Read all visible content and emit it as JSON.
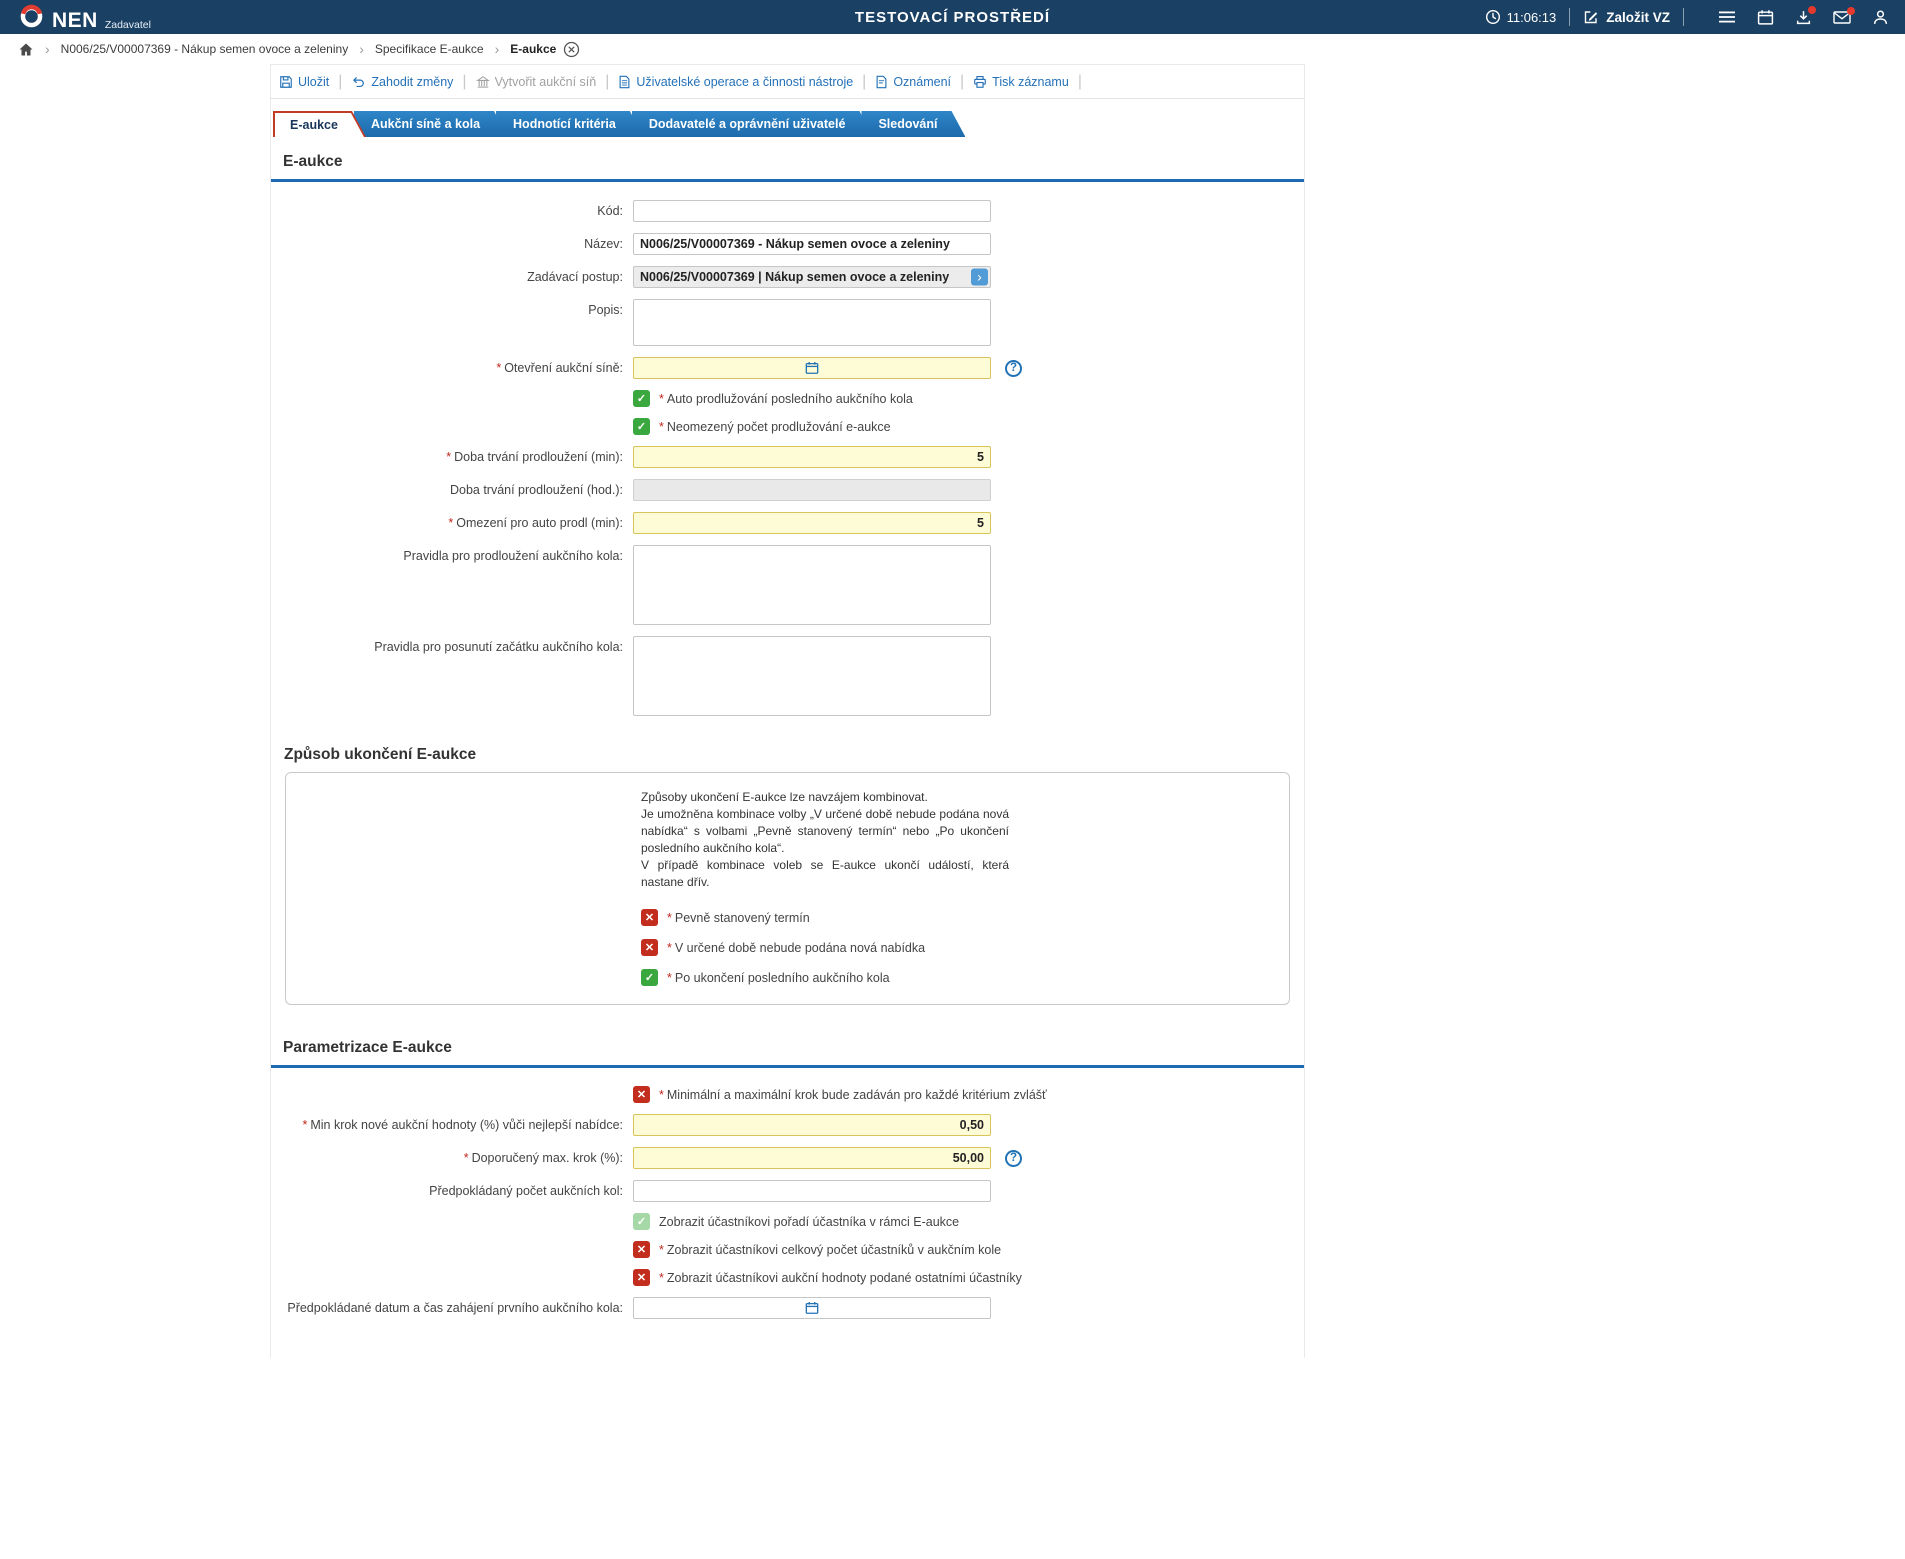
{
  "header": {
    "brand": "NEN",
    "brand_sub": "Zadavatel",
    "environment": "TESTOVACÍ PROSTŘEDÍ",
    "time": "11:06:13",
    "create_button": "Založit VZ"
  },
  "breadcrumb": {
    "item1": "N006/25/V00007369 - Nákup semen ovoce a zeleniny",
    "item2": "Specifikace E-aukce",
    "item3": "E-aukce"
  },
  "toolbar": {
    "save": "Uložit",
    "discard": "Zahodit změny",
    "create_room": "Vytvořit aukční síň",
    "user_ops": "Uživatelské operace a činnosti nástroje",
    "notices": "Oznámení",
    "print": "Tisk záznamu"
  },
  "tabs": {
    "t1": "E-aukce",
    "t2": "Aukční síně a kola",
    "t3": "Hodnotící kritéria",
    "t4": "Dodavatelé a oprávnění uživatelé",
    "t5": "Sledování"
  },
  "section1": {
    "title": "E-aukce",
    "kod": {
      "label": "Kód:",
      "value": ""
    },
    "nazev": {
      "label": "Název:",
      "value": "N006/25/V00007369 - Nákup semen ovoce a zeleniny"
    },
    "postup": {
      "label": "Zadávací postup:",
      "value": "N006/25/V00007369 | Nákup semen ovoce a zeleniny"
    },
    "popis": {
      "label": "Popis:"
    },
    "otevreni": {
      "req": "*",
      "label": "Otevření aukční síně:",
      "value": ""
    },
    "cb_auto": {
      "req": "*",
      "label": "Auto prodlužování posledního aukčního kola"
    },
    "cb_neomezeny": {
      "req": "*",
      "label": "Neomezený počet prodlužování e-aukce"
    },
    "doba_min": {
      "req": "*",
      "label": "Doba trvání prodloužení (min):",
      "value": "5"
    },
    "doba_hod": {
      "label": "Doba trvání prodloužení (hod.):",
      "value": ""
    },
    "omezeni": {
      "req": "*",
      "label": "Omezení pro auto prodl (min):",
      "value": "5"
    },
    "pravidla_prodlouzeni": {
      "label": "Pravidla pro prodloužení aukčního kola:"
    },
    "pravidla_posunuti": {
      "label": "Pravidla pro posunutí začátku aukčního kola:"
    }
  },
  "section2": {
    "title": "Způsob ukončení E-aukce",
    "info": "Způsoby ukončení E-aukce lze navzájem kombinovat.\nJe umožněna kombinace volby „V určené době nebude podána nová nabídka“ s volbami „Pevně stanovený termín“ nebo „Po ukončení posledního aukčního kola“.\nV případě kombinace voleb se E-aukce ukončí událostí, která nastane dřív.",
    "cb_termin": {
      "req": "*",
      "label": "Pevně stanovený termín"
    },
    "cb_nova_nabidka": {
      "req": "*",
      "label": "V určené době nebude podána nová nabídka"
    },
    "cb_posledni_kolo": {
      "req": "*",
      "label": "Po ukončení posledního aukčního kola"
    }
  },
  "section3": {
    "title": "Parametrizace E-aukce",
    "cb_minmax": {
      "req": "*",
      "label": "Minimální a maximální krok bude zadáván pro každé kritérium zvlášť"
    },
    "min_krok": {
      "req": "*",
      "label": "Min krok nové aukční hodnoty (%) vůči nejlepší nabídce:",
      "value": "0,50"
    },
    "max_krok": {
      "req": "*",
      "label": "Doporučený max. krok (%):",
      "value": "50,00"
    },
    "pocet_kol": {
      "label": "Předpokládaný počet aukčních kol:",
      "value": ""
    },
    "cb_poradi": {
      "label": "Zobrazit účastníkovi pořadí účastníka v rámci E-aukce"
    },
    "cb_pocet_ucastniku": {
      "req": "*",
      "label": "Zobrazit účastníkovi celkový počet účastníků v aukčním kole"
    },
    "cb_hodnoty": {
      "req": "*",
      "label": "Zobrazit účastníkovi aukční hodnoty podané ostatními účastníky"
    },
    "datum_zahajeni": {
      "label": "Předpokládané datum a čas zahájení prvního aukčního kola:",
      "value": ""
    }
  }
}
